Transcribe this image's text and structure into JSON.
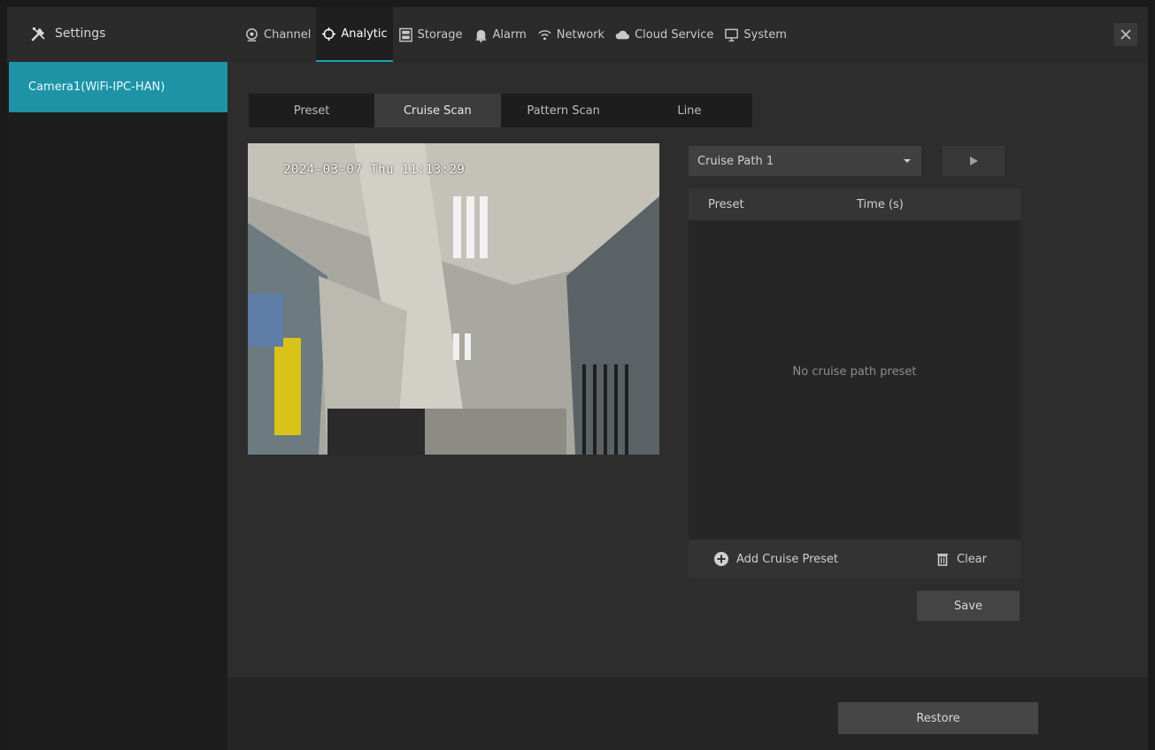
{
  "header": {
    "title": "Settings",
    "menu": [
      {
        "label": "Channel",
        "icon": "camera-icon"
      },
      {
        "label": "Analytic",
        "icon": "crosshair-icon",
        "active": true
      },
      {
        "label": "Storage",
        "icon": "storage-icon"
      },
      {
        "label": "Alarm",
        "icon": "bell-icon"
      },
      {
        "label": "Network",
        "icon": "network-icon"
      },
      {
        "label": "Cloud Service",
        "icon": "cloud-icon"
      },
      {
        "label": "System",
        "icon": "monitor-icon"
      }
    ],
    "close_icon": "close-icon"
  },
  "sidebar": {
    "items": [
      {
        "label": "Camera1(WiFi-IPC-HAN)",
        "active": true
      }
    ]
  },
  "subtabs": [
    {
      "label": "Preset"
    },
    {
      "label": "Cruise Scan",
      "active": true
    },
    {
      "label": "Pattern Scan"
    },
    {
      "label": "Line"
    }
  ],
  "preview": {
    "osd": "2024-03-07 Thu 11:13:29"
  },
  "cruise": {
    "selected": "Cruise Path 1",
    "columns": [
      "Preset",
      "Time (s)"
    ],
    "empty_text": "No cruise path preset",
    "add_label": "Add Cruise Preset",
    "clear_label": "Clear"
  },
  "buttons": {
    "save": "Save",
    "restore": "Restore"
  },
  "colors": {
    "accent": "#1e93a6",
    "background": "#2d2d2d"
  }
}
